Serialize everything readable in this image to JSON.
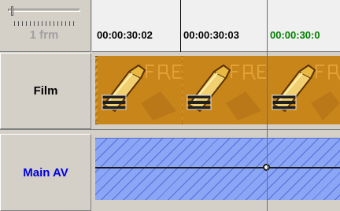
{
  "zoom": {
    "label": "1 frm",
    "level": 0.02
  },
  "ruler": {
    "timecodes": [
      {
        "text": "00:00:30:02",
        "color": "#000000"
      },
      {
        "text": "00:00:30:03",
        "color": "#000000"
      },
      {
        "text": "00:00:30:0",
        "color": "#008000"
      }
    ]
  },
  "tracks": {
    "film": {
      "label": "Film",
      "label_color": "#000000"
    },
    "av": {
      "label": "Main AV",
      "label_color": "#0000e0"
    }
  },
  "colors": {
    "film_clip": "#c8861a",
    "av_clip": "#8aa6f5",
    "current_timecode": "#008000"
  }
}
